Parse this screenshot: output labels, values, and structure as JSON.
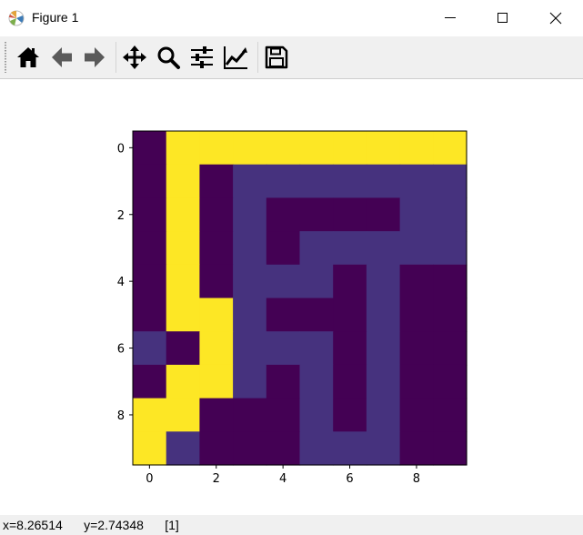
{
  "window": {
    "title": "Figure 1",
    "icon": "matplotlib-icon",
    "controls": [
      "minimize-icon",
      "maximize-icon",
      "close-icon"
    ]
  },
  "toolbar": {
    "tools": [
      {
        "id": "home",
        "icon": "home-icon",
        "label": "Home"
      },
      {
        "id": "back",
        "icon": "back-arrow-icon",
        "label": "Back"
      },
      {
        "id": "forward",
        "icon": "forward-arrow-icon",
        "label": "Forward"
      },
      {
        "id": "pan",
        "icon": "pan-move-icon",
        "label": "Pan"
      },
      {
        "id": "zoom",
        "icon": "zoom-magnifier-icon",
        "label": "Zoom"
      },
      {
        "id": "subplots",
        "icon": "subplots-sliders-icon",
        "label": "Subplots"
      },
      {
        "id": "customize",
        "icon": "customize-chart-icon",
        "label": "Customize"
      },
      {
        "id": "save",
        "icon": "save-disk-icon",
        "label": "Save"
      }
    ]
  },
  "status": {
    "text": "x=8.26514      y=2.74348      [1]"
  },
  "chart_data": {
    "type": "heatmap",
    "colormap": "viridis",
    "colors": {
      "0": "#440154",
      "1": "#46327e",
      "2": "#fde725"
    },
    "xticks": [
      0,
      2,
      4,
      6,
      8
    ],
    "yticks": [
      0,
      2,
      4,
      6,
      8
    ],
    "xlim": [
      -0.5,
      9.5
    ],
    "ylim": [
      9.5,
      -0.5
    ],
    "grid": false,
    "matrix": [
      [
        0,
        2,
        2,
        2,
        2,
        2,
        2,
        2,
        2,
        2
      ],
      [
        0,
        2,
        0,
        1,
        1,
        1,
        1,
        1,
        1,
        1
      ],
      [
        0,
        2,
        0,
        1,
        0,
        0,
        0,
        0,
        1,
        1
      ],
      [
        0,
        2,
        0,
        1,
        0,
        1,
        1,
        1,
        1,
        1
      ],
      [
        0,
        2,
        0,
        1,
        1,
        1,
        0,
        1,
        0,
        0
      ],
      [
        0,
        2,
        2,
        1,
        0,
        0,
        0,
        1,
        0,
        0
      ],
      [
        1,
        0,
        2,
        1,
        1,
        1,
        0,
        1,
        0,
        0
      ],
      [
        0,
        2,
        2,
        1,
        0,
        1,
        0,
        1,
        0,
        0
      ],
      [
        2,
        2,
        0,
        0,
        0,
        1,
        0,
        1,
        0,
        0
      ],
      [
        2,
        1,
        0,
        0,
        0,
        1,
        1,
        1,
        0,
        0
      ]
    ]
  }
}
